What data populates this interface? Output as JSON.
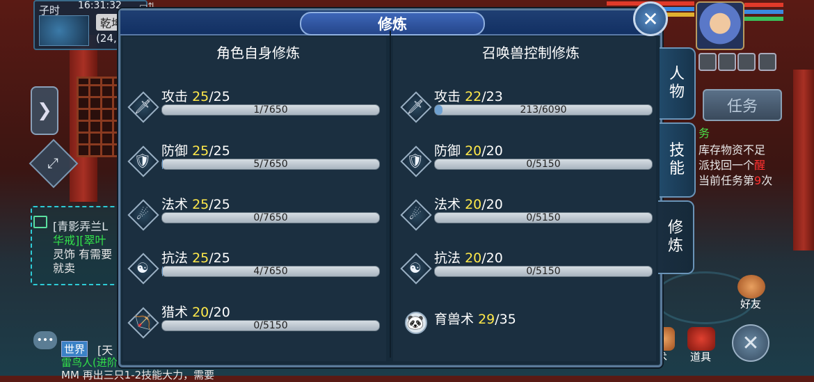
{
  "status": {
    "time_badge": "子时",
    "clock": "16:31:32",
    "map_name": "乾坤",
    "coords": "(24,"
  },
  "left_chat": {
    "lines": [
      "[青影弄兰L",
      "华戒][翠叶",
      "灵饰 有需要",
      "就卖"
    ]
  },
  "world_chat": {
    "tag": "世界",
    "text": "[天",
    "line2": "雷鸟人(进阶",
    "line3": "MM  再出三只1-2技能大力，需要"
  },
  "panel": {
    "title": "修炼",
    "left": {
      "title": "角色自身修炼",
      "rows": [
        {
          "name": "攻击",
          "level": "25",
          "max": "25",
          "progress": "1/7650",
          "fraction": 0.0001
        },
        {
          "name": "防御",
          "level": "25",
          "max": "25",
          "progress": "5/7650",
          "fraction": 0.0007
        },
        {
          "name": "法术",
          "level": "25",
          "max": "25",
          "progress": "0/7650",
          "fraction": 0
        },
        {
          "name": "抗法",
          "level": "25",
          "max": "25",
          "progress": "4/7650",
          "fraction": 0.0005
        },
        {
          "name": "猎术",
          "level": "20",
          "max": "20",
          "progress": "0/5150",
          "fraction": 0
        }
      ]
    },
    "right": {
      "title": "召唤兽控制修炼",
      "rows": [
        {
          "name": "攻击",
          "level": "22",
          "max": "23",
          "progress": "213/6090",
          "fraction": 0.035
        },
        {
          "name": "防御",
          "level": "20",
          "max": "20",
          "progress": "0/5150",
          "fraction": 0
        },
        {
          "name": "法术",
          "level": "20",
          "max": "20",
          "progress": "0/5150",
          "fraction": 0
        },
        {
          "name": "抗法",
          "level": "20",
          "max": "20",
          "progress": "0/5150",
          "fraction": 0
        }
      ],
      "pet_skill": {
        "name": "育兽术",
        "level": "29",
        "max": "35"
      }
    }
  },
  "tabs": [
    {
      "label": "人物",
      "active": false
    },
    {
      "label": "技能",
      "active": false
    },
    {
      "label": "修炼",
      "active": true
    }
  ],
  "right_hud": {
    "task_button": "任务",
    "task_title": "务",
    "task_lines": [
      "库存物资不足",
      "派找回一个",
      "当前任务第",
      "次"
    ],
    "task_highlight": "醒",
    "task_count": "9",
    "friend_label": "好友",
    "prop_label": "道具",
    "skill_label": "术"
  },
  "icons": {
    "attack": "sword-icon",
    "defense": "shield-icon",
    "magic": "staff-icon",
    "resist": "yin-yang-icon",
    "hunt": "bow-icon",
    "pet": "pet-panda-icon"
  }
}
